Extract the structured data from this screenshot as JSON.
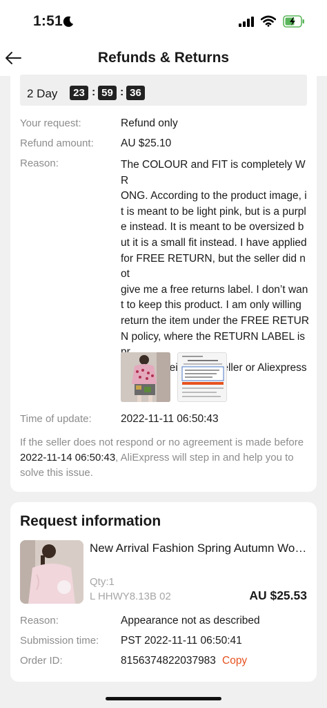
{
  "status_bar": {
    "time": "1:51"
  },
  "nav": {
    "title": "Refunds & Returns"
  },
  "countdown": {
    "days_label": "2 Day",
    "hours": "23",
    "minutes": "59",
    "seconds": "36",
    "separator": ":"
  },
  "details": {
    "request_label": "Your request:",
    "request_value": "Refund only",
    "amount_label": "Refund amount:",
    "amount_value": "AU $25.10",
    "reason_label": "Reason:",
    "reason_value": "The COLOUR and FIT is completely WR\nONG. According to the product image, i\nt is meant to be light pink, but is a purpl\ne instead. It is meant to be oversized b\nut it is a small fit instead. I have applied\nfor FREE RETURN, but the seller did not\ngive me a free returns label. I don’t wan\nt to keep this product. I am only willing\nreturn the item under the FREE RETUR\nN policy, where the RETURN LABEL is pr\novided by either the seller or Aliexpress\n.",
    "update_label": "Time of update:",
    "update_value": "2022-11-11 06:50:43"
  },
  "note": {
    "part1": "If the seller does not respond or no agreement is made before ",
    "deadline": "2022-11-14 06:50:43",
    "part2": ", AliExpress will step in and help you to solve this issue."
  },
  "request_info": {
    "title": "Request information",
    "product_title": "New Arrival Fashion Spring Autumn Women Sweater Pink",
    "qty": "Qty:1",
    "sku": "L HHWY8.13B 02",
    "price": "AU $25.53",
    "reason_label": "Reason:",
    "reason_value": "Appearance not as described",
    "submission_label": "Submission time:",
    "submission_value": "PST 2022-11-11 06:50:41",
    "order_label": "Order ID:",
    "order_value": "8156374822037983",
    "copy_label": "Copy"
  },
  "colors": {
    "accent": "#e6521f",
    "muted_text": "#8c8c8c",
    "countdown_tile": "#222222"
  },
  "icons": [
    "moon-icon",
    "signal-icon",
    "wifi-icon",
    "battery-icon",
    "back-arrow-icon"
  ]
}
